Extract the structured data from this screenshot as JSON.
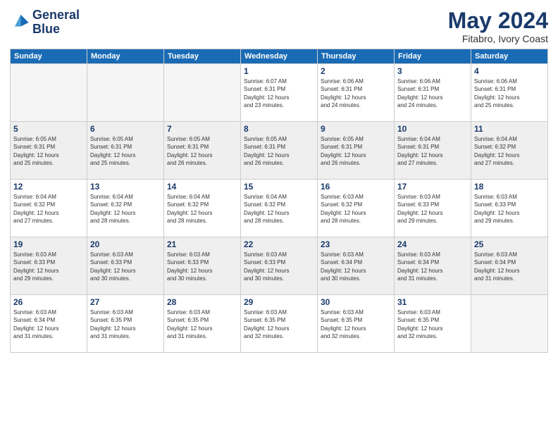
{
  "logo": {
    "line1": "General",
    "line2": "Blue"
  },
  "title": "May 2024",
  "subtitle": "Fitabro, Ivory Coast",
  "weekdays": [
    "Sunday",
    "Monday",
    "Tuesday",
    "Wednesday",
    "Thursday",
    "Friday",
    "Saturday"
  ],
  "weeks": [
    [
      {
        "day": "",
        "info": ""
      },
      {
        "day": "",
        "info": ""
      },
      {
        "day": "",
        "info": ""
      },
      {
        "day": "1",
        "info": "Sunrise: 6:07 AM\nSunset: 6:31 PM\nDaylight: 12 hours\nand 23 minutes."
      },
      {
        "day": "2",
        "info": "Sunrise: 6:06 AM\nSunset: 6:31 PM\nDaylight: 12 hours\nand 24 minutes."
      },
      {
        "day": "3",
        "info": "Sunrise: 6:06 AM\nSunset: 6:31 PM\nDaylight: 12 hours\nand 24 minutes."
      },
      {
        "day": "4",
        "info": "Sunrise: 6:06 AM\nSunset: 6:31 PM\nDaylight: 12 hours\nand 25 minutes."
      }
    ],
    [
      {
        "day": "5",
        "info": "Sunrise: 6:05 AM\nSunset: 6:31 PM\nDaylight: 12 hours\nand 25 minutes."
      },
      {
        "day": "6",
        "info": "Sunrise: 6:05 AM\nSunset: 6:31 PM\nDaylight: 12 hours\nand 25 minutes."
      },
      {
        "day": "7",
        "info": "Sunrise: 6:05 AM\nSunset: 6:31 PM\nDaylight: 12 hours\nand 26 minutes."
      },
      {
        "day": "8",
        "info": "Sunrise: 6:05 AM\nSunset: 6:31 PM\nDaylight: 12 hours\nand 26 minutes."
      },
      {
        "day": "9",
        "info": "Sunrise: 6:05 AM\nSunset: 6:31 PM\nDaylight: 12 hours\nand 26 minutes."
      },
      {
        "day": "10",
        "info": "Sunrise: 6:04 AM\nSunset: 6:31 PM\nDaylight: 12 hours\nand 27 minutes."
      },
      {
        "day": "11",
        "info": "Sunrise: 6:04 AM\nSunset: 6:32 PM\nDaylight: 12 hours\nand 27 minutes."
      }
    ],
    [
      {
        "day": "12",
        "info": "Sunrise: 6:04 AM\nSunset: 6:32 PM\nDaylight: 12 hours\nand 27 minutes."
      },
      {
        "day": "13",
        "info": "Sunrise: 6:04 AM\nSunset: 6:32 PM\nDaylight: 12 hours\nand 28 minutes."
      },
      {
        "day": "14",
        "info": "Sunrise: 6:04 AM\nSunset: 6:32 PM\nDaylight: 12 hours\nand 28 minutes."
      },
      {
        "day": "15",
        "info": "Sunrise: 6:04 AM\nSunset: 6:32 PM\nDaylight: 12 hours\nand 28 minutes."
      },
      {
        "day": "16",
        "info": "Sunrise: 6:03 AM\nSunset: 6:32 PM\nDaylight: 12 hours\nand 28 minutes."
      },
      {
        "day": "17",
        "info": "Sunrise: 6:03 AM\nSunset: 6:33 PM\nDaylight: 12 hours\nand 29 minutes."
      },
      {
        "day": "18",
        "info": "Sunrise: 6:03 AM\nSunset: 6:33 PM\nDaylight: 12 hours\nand 29 minutes."
      }
    ],
    [
      {
        "day": "19",
        "info": "Sunrise: 6:03 AM\nSunset: 6:33 PM\nDaylight: 12 hours\nand 29 minutes."
      },
      {
        "day": "20",
        "info": "Sunrise: 6:03 AM\nSunset: 6:33 PM\nDaylight: 12 hours\nand 30 minutes."
      },
      {
        "day": "21",
        "info": "Sunrise: 6:03 AM\nSunset: 6:33 PM\nDaylight: 12 hours\nand 30 minutes."
      },
      {
        "day": "22",
        "info": "Sunrise: 6:03 AM\nSunset: 6:33 PM\nDaylight: 12 hours\nand 30 minutes."
      },
      {
        "day": "23",
        "info": "Sunrise: 6:03 AM\nSunset: 6:34 PM\nDaylight: 12 hours\nand 30 minutes."
      },
      {
        "day": "24",
        "info": "Sunrise: 6:03 AM\nSunset: 6:34 PM\nDaylight: 12 hours\nand 31 minutes."
      },
      {
        "day": "25",
        "info": "Sunrise: 6:03 AM\nSunset: 6:34 PM\nDaylight: 12 hours\nand 31 minutes."
      }
    ],
    [
      {
        "day": "26",
        "info": "Sunrise: 6:03 AM\nSunset: 6:34 PM\nDaylight: 12 hours\nand 31 minutes."
      },
      {
        "day": "27",
        "info": "Sunrise: 6:03 AM\nSunset: 6:35 PM\nDaylight: 12 hours\nand 31 minutes."
      },
      {
        "day": "28",
        "info": "Sunrise: 6:03 AM\nSunset: 6:35 PM\nDaylight: 12 hours\nand 31 minutes."
      },
      {
        "day": "29",
        "info": "Sunrise: 6:03 AM\nSunset: 6:35 PM\nDaylight: 12 hours\nand 32 minutes."
      },
      {
        "day": "30",
        "info": "Sunrise: 6:03 AM\nSunset: 6:35 PM\nDaylight: 12 hours\nand 32 minutes."
      },
      {
        "day": "31",
        "info": "Sunrise: 6:03 AM\nSunset: 6:35 PM\nDaylight: 12 hours\nand 32 minutes."
      },
      {
        "day": "",
        "info": ""
      }
    ]
  ]
}
